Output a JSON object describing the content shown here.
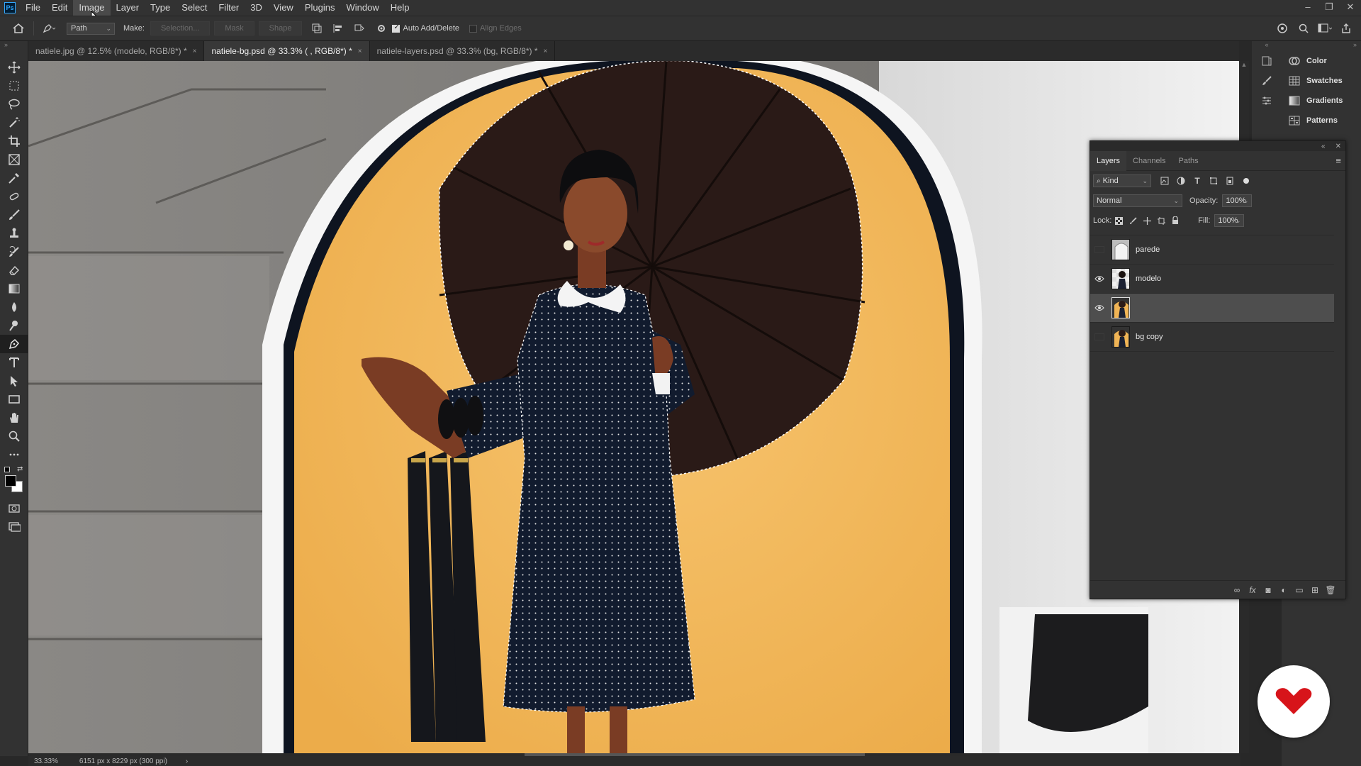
{
  "app": {
    "logo_text": "Ps"
  },
  "menu": {
    "items": [
      "File",
      "Edit",
      "Image",
      "Layer",
      "Type",
      "Select",
      "Filter",
      "3D",
      "View",
      "Plugins",
      "Window",
      "Help"
    ],
    "hovered": "Image"
  },
  "window_controls": {
    "minimize": "‒",
    "restore": "❐",
    "close": "✕"
  },
  "options_bar": {
    "tool_mode": "Path",
    "make_label": "Make:",
    "selection_btn": "Selection...",
    "mask_btn": "Mask",
    "shape_btn": "Shape",
    "auto_add_delete": {
      "label": "Auto Add/Delete",
      "checked": true
    },
    "align_edges": {
      "label": "Align Edges",
      "checked": false
    }
  },
  "tabs": [
    {
      "label": "natiele.jpg @ 12.5% (modelo, RGB/8*) *",
      "active": false
    },
    {
      "label": "natiele-bg.psd @ 33.3% ( , RGB/8*) *",
      "active": true
    },
    {
      "label": "natiele-layers.psd @ 33.3% (bg, RGB/8*) *",
      "active": false
    }
  ],
  "tab_close_glyph": "×",
  "toolbar": {
    "tools": [
      "move",
      "marquee",
      "lasso",
      "magic-wand",
      "crop",
      "frame",
      "eyedropper",
      "healing",
      "brush",
      "stamp",
      "history-brush",
      "eraser",
      "gradient",
      "blur",
      "dodge",
      "pen",
      "type",
      "path-select",
      "rectangle",
      "hand",
      "zoom",
      "more"
    ],
    "active_tool": "pen"
  },
  "status_bar": {
    "zoom": "33.33%",
    "doc_info": "6151 px x 8229 px (300 ppi)",
    "arrow": "›"
  },
  "dock": {
    "items": [
      {
        "label": "Color",
        "icon": "color-wheel-icon"
      },
      {
        "label": "Swatches",
        "icon": "swatches-grid-icon"
      },
      {
        "label": "Gradients",
        "icon": "gradient-icon"
      },
      {
        "label": "Patterns",
        "icon": "patterns-grid-icon"
      }
    ]
  },
  "layers_panel": {
    "tabs": [
      "Layers",
      "Channels",
      "Paths"
    ],
    "active_tab": "Layers",
    "filter_kind": "Kind",
    "blend_mode": "Normal",
    "opacity_label": "Opacity:",
    "opacity": "100%",
    "lock_label": "Lock:",
    "fill_label": "Fill:",
    "fill": "100%",
    "layers": [
      {
        "name": "parede",
        "visible": false,
        "selected": false,
        "thumb": "wall"
      },
      {
        "name": "modelo",
        "visible": true,
        "selected": false,
        "thumb": "model"
      },
      {
        "name": "",
        "visible": true,
        "selected": true,
        "thumb": "bg"
      },
      {
        "name": "bg copy",
        "visible": false,
        "selected": false,
        "thumb": "bg"
      }
    ]
  },
  "colors": {
    "accent_selected_layer": "#4e4e4e",
    "badge_red": "#d7141a",
    "canvas_bg_yellow": "#f2b65a"
  }
}
